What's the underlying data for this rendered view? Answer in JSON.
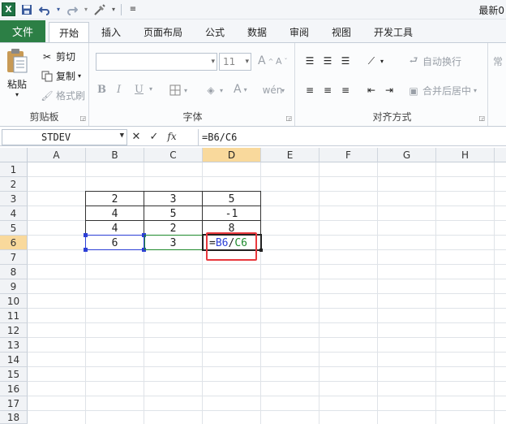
{
  "app": {
    "title": "最新0"
  },
  "qat": {
    "logo": "X"
  },
  "tabs": [
    {
      "label": "文件"
    },
    {
      "label": "开始"
    },
    {
      "label": "插入"
    },
    {
      "label": "页面布局"
    },
    {
      "label": "公式"
    },
    {
      "label": "数据"
    },
    {
      "label": "审阅"
    },
    {
      "label": "视图"
    },
    {
      "label": "开发工具"
    }
  ],
  "ribbon": {
    "clipboard": {
      "paste": "粘贴",
      "cut": "剪切",
      "copy": "复制",
      "format_painter": "格式刷",
      "group_label": "剪贴板"
    },
    "font": {
      "size": "11",
      "bold": "B",
      "italic": "I",
      "underline": "U",
      "grow": "A",
      "shrink": "A",
      "font_color": "A",
      "group_label": "字体"
    },
    "alignment": {
      "wrap": "自动换行",
      "merge": "合并后居中",
      "group_label": "对齐方式"
    },
    "number": {
      "format": "常"
    }
  },
  "formula_bar": {
    "name_box": "STDEV",
    "fx": "fx",
    "formula": "=B6/C6"
  },
  "columns": [
    "A",
    "B",
    "C",
    "D",
    "E",
    "F",
    "G",
    "H"
  ],
  "rows": [
    "1",
    "2",
    "3",
    "4",
    "5",
    "6",
    "7",
    "8",
    "9",
    "10",
    "11",
    "12",
    "13",
    "14",
    "15",
    "16",
    "17",
    "18"
  ],
  "table": {
    "rows": [
      {
        "row": "3",
        "b": "2",
        "c": "3",
        "d": "5"
      },
      {
        "row": "4",
        "b": "4",
        "c": "5",
        "d": "-1"
      },
      {
        "row": "5",
        "b": "4",
        "c": "2",
        "d": "8"
      },
      {
        "row": "6",
        "b": "6",
        "c": "3",
        "d": ""
      }
    ]
  },
  "editing": {
    "eq": "=",
    "ref1": "B6",
    "slash": "/",
    "ref2": "C6"
  },
  "colors": {
    "file_tab": "#2c7f45",
    "ref_b": "#2c3fd6",
    "ref_c": "#1f8a2d",
    "highlight": "#e8383d",
    "selected_header": "#f9d99c"
  }
}
